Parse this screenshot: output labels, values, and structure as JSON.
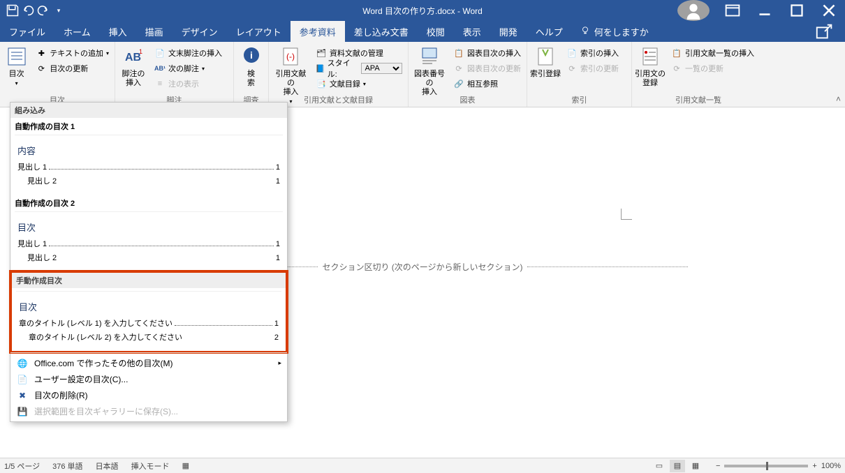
{
  "titlebar": {
    "title": "Word  目次の作り方.docx  -  Word"
  },
  "tabs": {
    "file": "ファイル",
    "home": "ホーム",
    "insert": "挿入",
    "draw": "描画",
    "design": "デザイン",
    "layout": "レイアウト",
    "references": "参考資料",
    "mailings": "差し込み文書",
    "review": "校閲",
    "view": "表示",
    "developer": "開発",
    "help": "ヘルプ",
    "tellme": "何をしますか"
  },
  "ribbon": {
    "toc_group": {
      "toc": "目次",
      "add_text": "テキストの追加",
      "update_toc": "目次の更新",
      "label": "目次"
    },
    "footnotes_group": {
      "insert_footnote": "脚注の\n挿入",
      "insert_endnote": "文末脚注の挿入",
      "next_footnote": "次の脚注",
      "show_notes": "注の表示",
      "label": "脚注"
    },
    "research_group": {
      "search": "検\n索",
      "label": "調査"
    },
    "citations_group": {
      "insert_citation": "引用文献の\n挿入",
      "manage_sources": "資料文献の管理",
      "style": "スタイル:",
      "style_value": "APA",
      "bibliography": "文献目録",
      "label": "引用文献と文献目録"
    },
    "captions_group": {
      "insert_caption": "図表番号の\n挿入",
      "insert_tof": "図表目次の挿入",
      "update_tof": "図表目次の更新",
      "cross_ref": "相互参照",
      "label": "図表"
    },
    "index_group": {
      "mark_entry": "索引登録",
      "insert_index": "索引の挿入",
      "update_index": "索引の更新",
      "label": "索引"
    },
    "toa_group": {
      "mark_citation": "引用文の\n登録",
      "insert_toa": "引用文献一覧の挿入",
      "update_toa": "一覧の更新",
      "label": "引用文献一覧"
    }
  },
  "gallery": {
    "builtin_header": "組み込み",
    "auto1": {
      "name": "自動作成の目次 1",
      "title": "内容",
      "e1_text": "見出し 1",
      "e1_page": "1",
      "e2_text": "見出し 2",
      "e2_page": "1"
    },
    "auto2": {
      "name": "自動作成の目次 2",
      "title": "目次",
      "e1_text": "見出し 1",
      "e1_page": "1",
      "e2_text": "見出し 2",
      "e2_page": "1"
    },
    "manual_header": "手動作成目次",
    "manual": {
      "title": "目次",
      "e1_text": "章のタイトル (レベル 1) を入力してください",
      "e1_page": "1",
      "e2_text": "章のタイトル (レベル 2) を入力してください",
      "e2_page": "2"
    },
    "menu": {
      "office": "Office.com で作ったその他の目次(M)",
      "custom": "ユーザー設定の目次(C)...",
      "remove": "目次の削除(R)",
      "save": "選択範囲を目次ギャラリーに保存(S)..."
    }
  },
  "document": {
    "section_break": "セクション区切り (次のページから新しいセクション)"
  },
  "statusbar": {
    "page": "1/5 ページ",
    "words": "376 単語",
    "lang": "日本語",
    "mode": "挿入モード",
    "zoom": "100%"
  }
}
